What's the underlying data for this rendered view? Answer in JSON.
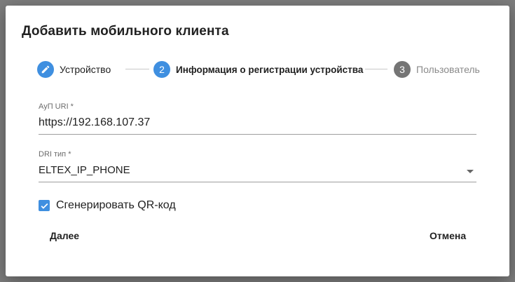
{
  "dialog": {
    "title": "Добавить мобильного клиента"
  },
  "colors": {
    "accent": "#3f8fe0",
    "step_inactive": "#757575",
    "text_primary": "#212121",
    "text_disabled": "#8a8a8a"
  },
  "stepper": {
    "steps": [
      {
        "index": "1",
        "label": "Устройство",
        "state": "completed",
        "icon": "pencil-icon"
      },
      {
        "index": "2",
        "label": "Информация о регистрации устройства",
        "state": "active"
      },
      {
        "index": "3",
        "label": "Пользователь",
        "state": "inactive"
      }
    ]
  },
  "form": {
    "aup_uri": {
      "label": "АуП URI *",
      "value": "https://192.168.107.37"
    },
    "dri_type": {
      "label": "DRI тип *",
      "value": "ELTEX_IP_PHONE",
      "icon": "dropdown-arrow-icon"
    },
    "generate_qr": {
      "label": "Сгенерировать QR-код",
      "checked": true,
      "icon": "checkmark-icon"
    }
  },
  "actions": {
    "next_label": "Далее",
    "cancel_label": "Отмена"
  }
}
